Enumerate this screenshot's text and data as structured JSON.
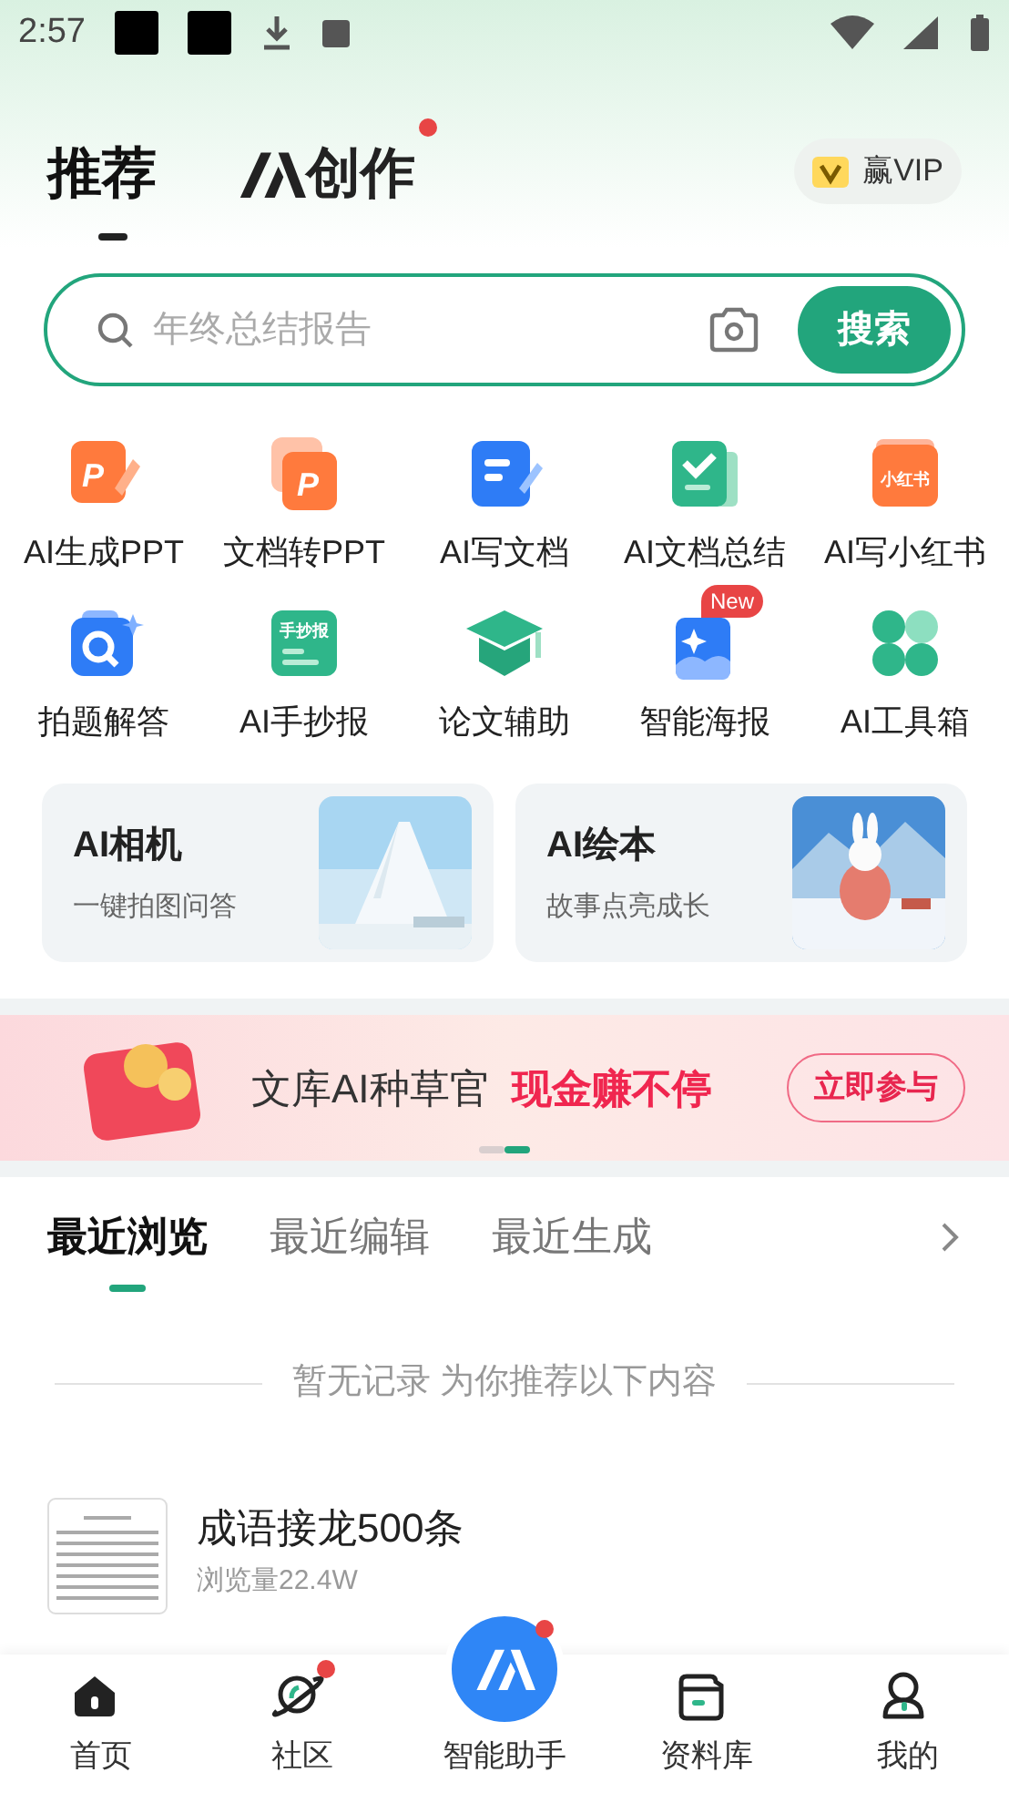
{
  "status_bar": {
    "time": "2:57"
  },
  "header": {
    "tabs": [
      {
        "label": "推荐",
        "selected": true,
        "kind": "text",
        "badge": false
      },
      {
        "label": "创作",
        "selected": false,
        "kind": "ai",
        "badge": true
      }
    ],
    "vip_button": "赢VIP"
  },
  "search": {
    "placeholder": "年终总结报告",
    "button": "搜索"
  },
  "tools": [
    {
      "label": "AI生成PPT",
      "icon_text": "P"
    },
    {
      "label": "文档转PPT",
      "icon_text": "P"
    },
    {
      "label": "AI写文档"
    },
    {
      "label": "AI文档总结"
    },
    {
      "label": "AI写小红书",
      "icon_text": "小红书"
    },
    {
      "label": "拍题解答"
    },
    {
      "label": "AI手抄报",
      "icon_text": "手抄报"
    },
    {
      "label": "论文辅助"
    },
    {
      "label": "智能海报",
      "badge": "New"
    },
    {
      "label": "AI工具箱"
    }
  ],
  "feature_cards": [
    {
      "title": "AI相机",
      "subtitle": "一键拍图问答"
    },
    {
      "title": "AI绘本",
      "subtitle": "故事点亮成长"
    }
  ],
  "banner": {
    "title": "文库AI种草官",
    "highlight": "现金赚不停",
    "button": "立即参与",
    "pages": [
      {
        "selected": false
      },
      {
        "selected": true
      }
    ]
  },
  "recent_tabs": [
    {
      "label": "最近浏览",
      "selected": true
    },
    {
      "label": "最近编辑",
      "selected": false
    },
    {
      "label": "最近生成",
      "selected": false
    }
  ],
  "empty_message": "暂无记录 为你推荐以下内容",
  "documents": [
    {
      "title": "成语接龙500条",
      "views": "浏览量22.4W"
    }
  ],
  "bottom_nav": [
    {
      "label": "首页",
      "kind": "home",
      "badge": false
    },
    {
      "label": "社区",
      "kind": "planet",
      "badge": true
    },
    {
      "label": "智能助手",
      "kind": "assistant",
      "badge": true
    },
    {
      "label": "资料库",
      "kind": "folder",
      "badge": false
    },
    {
      "label": "我的",
      "kind": "person",
      "badge": false
    }
  ]
}
